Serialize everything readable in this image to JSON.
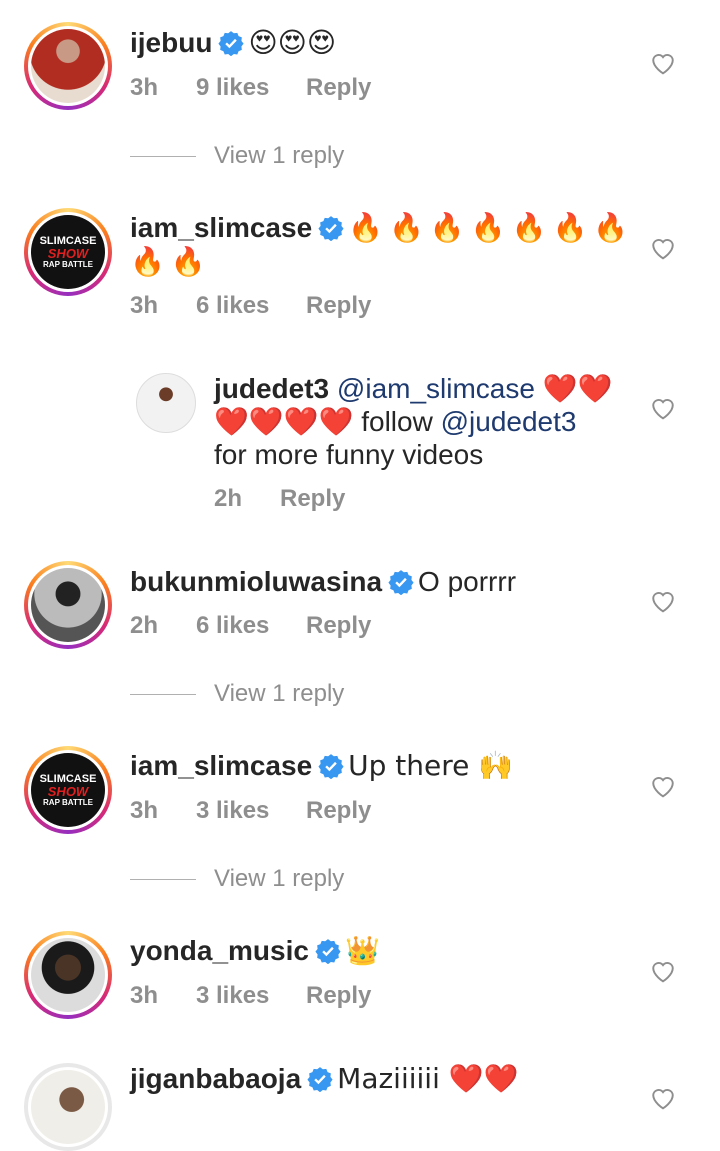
{
  "comments": [
    {
      "username": "ijebuu",
      "text": "😍😍😍",
      "time": "3h",
      "likes": "9 likes",
      "reply": "Reply",
      "view_replies": "View 1 reply"
    },
    {
      "username": "iam_slimcase",
      "text": "🔥🔥🔥🔥🔥🔥🔥🔥🔥",
      "time": "3h",
      "likes": "6 likes",
      "reply": "Reply",
      "avatar_text": {
        "line1": "SLIMCASE",
        "line2": "SHOW",
        "line3": "RAP BATTLE"
      }
    },
    {
      "username": "bukunmioluwasina",
      "text": "O porrrr",
      "time": "2h",
      "likes": "6 likes",
      "reply": "Reply",
      "view_replies": "View 1 reply"
    },
    {
      "username": "iam_slimcase",
      "text": "Up there 🙌",
      "time": "3h",
      "likes": "3 likes",
      "reply": "Reply",
      "view_replies": "View 1 reply",
      "avatar_text": {
        "line1": "SLIMCASE",
        "line2": "SHOW",
        "line3": "RAP BATTLE"
      }
    },
    {
      "username": "yonda_music",
      "text": "👑",
      "time": "3h",
      "likes": "3 likes",
      "reply": "Reply"
    },
    {
      "username": "jiganbabaoja",
      "text": "Maziiiiii ❤️❤️"
    }
  ],
  "reply": {
    "username": "judedet3",
    "mention": "@iam_slimcase",
    "hearts_1": "❤️❤️",
    "hearts_2": "❤️❤️❤️❤️",
    "follow": "follow",
    "mention2": "@judedet3",
    "rest": "for more funny videos",
    "time": "2h",
    "reply": "Reply"
  },
  "colors": {
    "verified": "#3897f0",
    "meta": "#8e8e8e",
    "mention": "#1e3a6e",
    "heart_outline": "#8e8e8e"
  },
  "icons": {
    "like": "heart-outline-icon",
    "verified": "verified-badge-icon"
  }
}
